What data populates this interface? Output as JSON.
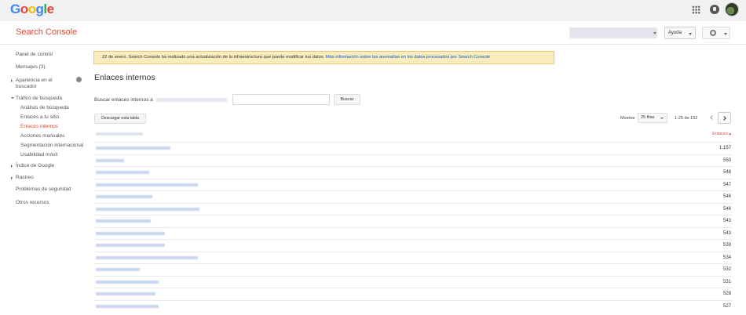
{
  "google_bar": {
    "logo_letters": [
      {
        "ch": "G",
        "color": "#4285f4"
      },
      {
        "ch": "o",
        "color": "#ea4335"
      },
      {
        "ch": "o",
        "color": "#fbbc05"
      },
      {
        "ch": "g",
        "color": "#4285f4"
      },
      {
        "ch": "l",
        "color": "#34a853"
      },
      {
        "ch": "e",
        "color": "#ea4335"
      }
    ]
  },
  "header": {
    "title": "Search Console",
    "help_label": "Ayuda"
  },
  "sidebar": {
    "items": [
      {
        "label": "Panel de control",
        "level": 0
      },
      {
        "label": "Mensajes (3)",
        "level": 0
      },
      {
        "label": "Apariencia en el buscador",
        "level": 0,
        "arrow": "right"
      },
      {
        "label": "Tráfico de búsqueda",
        "level": 0,
        "arrow": "down"
      },
      {
        "label": "Análisis de búsqueda",
        "level": 1
      },
      {
        "label": "Enlaces a tu sitio",
        "level": 1
      },
      {
        "label": "Enlaces internos",
        "level": 1,
        "active": true
      },
      {
        "label": "Acciones manuales",
        "level": 1
      },
      {
        "label": "Segmentación internacional",
        "level": 1
      },
      {
        "label": "Usabilidad móvil",
        "level": 1
      },
      {
        "label": "Índice de Google",
        "level": 0,
        "arrow": "right"
      },
      {
        "label": "Rastreo",
        "level": 0,
        "arrow": "right"
      },
      {
        "label": "Problemas de seguridad",
        "level": 0
      },
      {
        "label": "Otros recursos",
        "level": 0
      }
    ]
  },
  "banner": {
    "text": "22 de enero. Search Console ha realizado una actualización de la infraestructura que puede modificar tus datos.",
    "link": "Más información sobre las anomalías en los datos procesados por Search Console"
  },
  "main": {
    "title": "Enlaces internos",
    "search_label": "Buscar enlaces internos a",
    "search_button": "Buscar",
    "download_button": "Descargar esta tabla",
    "pager_show": "Mostrar",
    "pager_rows": "25 filas",
    "pager_range": "1-25 de 152",
    "column_links": "Enlaces ▴"
  },
  "colors": {
    "accent_red": "#dd4b39",
    "link_blue": "#15c",
    "banner_bg": "#f9edbe"
  },
  "rows": [
    {
      "count": "1.157"
    },
    {
      "count": "550"
    },
    {
      "count": "548"
    },
    {
      "count": "547"
    },
    {
      "count": "546"
    },
    {
      "count": "546"
    },
    {
      "count": "543"
    },
    {
      "count": "543"
    },
    {
      "count": "539"
    },
    {
      "count": "534"
    },
    {
      "count": "532"
    },
    {
      "count": "531"
    },
    {
      "count": "528"
    },
    {
      "count": "527"
    }
  ]
}
